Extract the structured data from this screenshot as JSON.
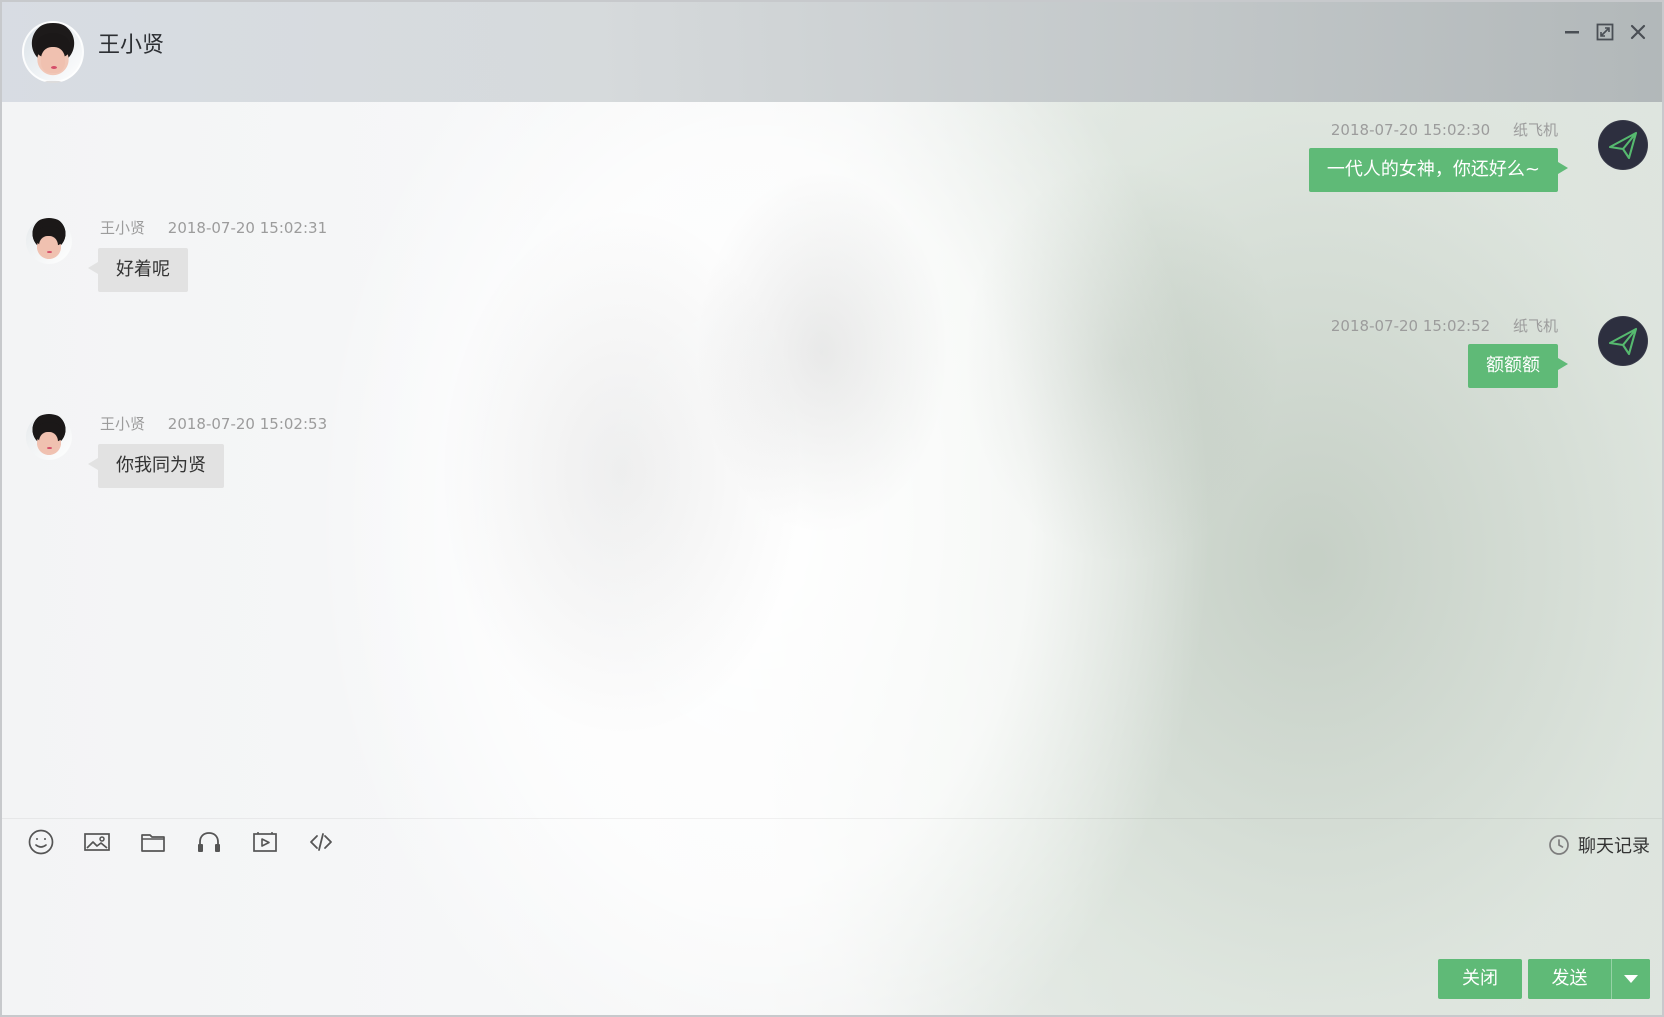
{
  "header": {
    "title": "王小贤"
  },
  "window_controls": {
    "minimize_icon": "minimize-icon",
    "maximize_icon": "maximize-icon",
    "close_icon": "close-icon"
  },
  "messages": [
    {
      "side": "right",
      "timestamp": "2018-07-20 15:02:30",
      "sender": "纸飞机",
      "text": "一代人的女神，你还好么~"
    },
    {
      "side": "left",
      "timestamp": "2018-07-20 15:02:31",
      "sender": "王小贤",
      "text": "好着呢"
    },
    {
      "side": "right",
      "timestamp": "2018-07-20 15:02:52",
      "sender": "纸飞机",
      "text": "额额额"
    },
    {
      "side": "left",
      "timestamp": "2018-07-20 15:02:53",
      "sender": "王小贤",
      "text": "你我同为贤"
    }
  ],
  "toolbar": {
    "items": [
      "emoji-icon",
      "image-icon",
      "folder-icon",
      "headphones-icon",
      "video-icon",
      "code-icon"
    ],
    "history_label": "聊天记录"
  },
  "buttons": {
    "close_label": "关闭",
    "send_label": "发送"
  },
  "colors": {
    "accent": "#5fba77",
    "dark_avatar": "#2d2f3f",
    "gray_bubble": "#e2e2e2"
  }
}
